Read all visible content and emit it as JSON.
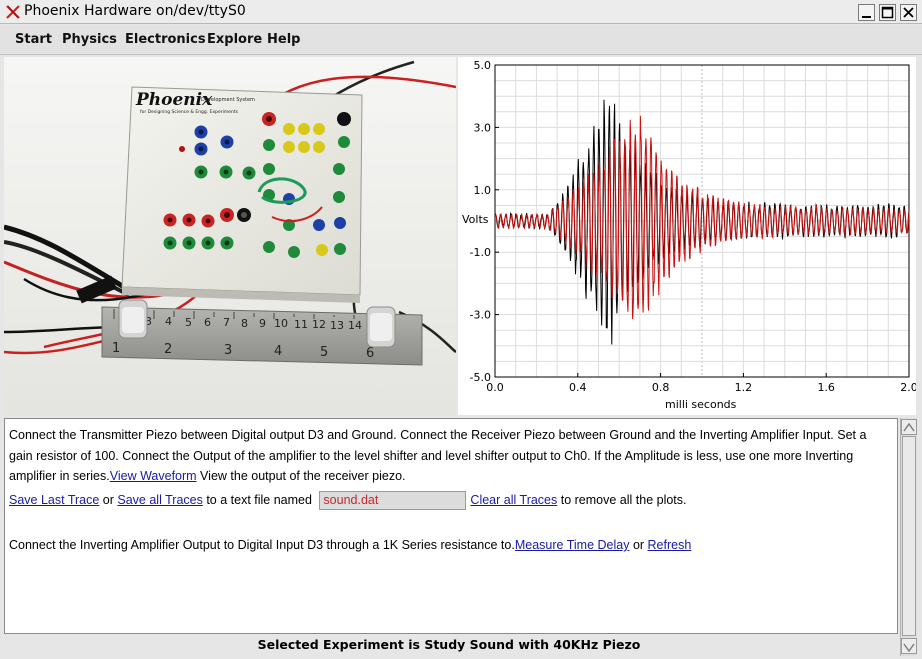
{
  "window": {
    "title": "Phoenix Hardware on/dev/ttyS0",
    "app_icon": "x-close-icon",
    "controls": [
      "minimize-icon",
      "maximize-icon",
      "close-icon"
    ]
  },
  "menu": [
    "Start",
    "Physics",
    "Electronics",
    "Explore",
    "Help"
  ],
  "photo": {
    "brand": "Phoenix",
    "brand_subtitle": "Development System",
    "brand_subtitle2": "for Designing Science & Engg. Experiments",
    "ruler_marks_top": [
      "3",
      "4",
      "5",
      "6",
      "7",
      "8",
      "9",
      "10",
      "11",
      "12",
      "13",
      "14",
      "15"
    ],
    "ruler_marks_bottom": [
      "1",
      "2",
      "3",
      "4",
      "5",
      "6"
    ]
  },
  "plot": {
    "y_label": "Volts",
    "x_label": "milli seconds",
    "y_ticks": [
      "5.0",
      "3.0",
      "1.0",
      "-1.0",
      "-3.0",
      "-5.0"
    ],
    "x_ticks": [
      "0.0",
      "0.4",
      "0.8",
      "1.2",
      "1.6",
      "2.0"
    ],
    "colors": {
      "trace_1": "#000000",
      "trace_2": "#cc1111",
      "grid": "#dcdcdc"
    }
  },
  "chart_data": {
    "type": "line",
    "title": "",
    "xlabel": "milli seconds",
    "ylabel": "Volts",
    "xlim": [
      0,
      2.0
    ],
    "ylim": [
      -5.0,
      5.0
    ],
    "grid": true,
    "series": [
      {
        "color": "#000000",
        "description_points": {
          "burst_start_ms": 0.26,
          "burst_peak_ms": 0.55,
          "peak_amplitude_v": 4.0,
          "tail_amplitude_v": 0.5
        }
      },
      {
        "color": "#cc1111",
        "description_points": {
          "burst_start_ms": 0.26,
          "burst_peak_ms": 0.7,
          "peak_amplitude_v": 3.6,
          "tail_amplitude_v": 0.4
        }
      }
    ]
  },
  "text": {
    "para1_before_link": "Connect the Transmitter Piezo between Digital output D3 and Ground. Connect the Receiver Piezo between Ground and the Inverting Amplifier Input. Set a gain resistor of 100. Connect the Output of the amplifier to the level shifter and level shifter output to Ch0. If the Amplitude is less, use one more Inverting amplifier in series.",
    "view_waveform_link": "View Waveform",
    "para1_after_link": " View the output of the receiver piezo.",
    "save_last_link": "Save Last Trace",
    "or_text": " or ",
    "save_all_link": "Save all Traces",
    "to_file_text": " to a text file named ",
    "filename_value": "sound.dat",
    "clear_all_link": "Clear all Traces",
    "remove_text": " to remove all the plots.",
    "para3_before_link": "Connect the Inverting Amplifier Output to Digital Input D3 through a 1K Series resistance to.",
    "measure_link": "Measure Time Delay",
    "or_text2": " or ",
    "refresh_link": "Refresh"
  },
  "status": "Selected Experiment is Study Sound with 40KHz Piezo"
}
